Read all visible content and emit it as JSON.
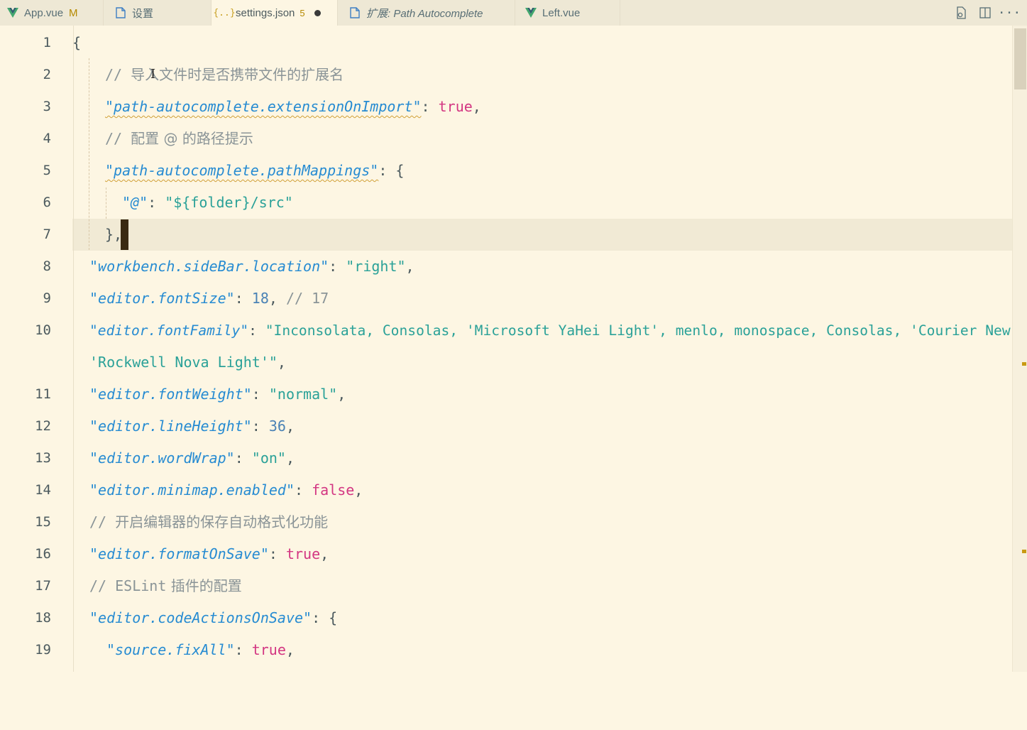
{
  "tabs": [
    {
      "label": "App.vue",
      "modified": "M",
      "icon": "vue-icon"
    },
    {
      "label": "设置",
      "icon": "settings-file-icon"
    },
    {
      "label": "settings.json",
      "count": "5",
      "icon": "json-icon",
      "active": true
    },
    {
      "label": "扩展: Path Autocomplete",
      "icon": "extension-file-icon"
    },
    {
      "label": "Left.vue",
      "icon": "vue-icon"
    }
  ],
  "toolbar": {
    "open_settings_icon": "open-settings-icon",
    "split_icon": "split-editor-icon",
    "more_icon": "more-actions-icon",
    "more_glyph": "···"
  },
  "editor": {
    "line_numbers": [
      "1",
      "2",
      "3",
      "4",
      "5",
      "6",
      "7",
      "8",
      "9",
      "10",
      "11",
      "12",
      "13",
      "14",
      "15",
      "16",
      "17",
      "18",
      "19"
    ],
    "l1": {
      "brace": "{"
    },
    "l2": {
      "slashes": "// ",
      "text": "导入文件时是否携带文件的扩展名"
    },
    "l3": {
      "key": "\"path-autocomplete.extensionOnImport\"",
      "colon": ": ",
      "value": "true",
      "tail": ","
    },
    "l4": {
      "slashes": "// ",
      "text": "配置 @ 的路径提示"
    },
    "l5": {
      "key": "\"path-autocomplete.pathMappings\"",
      "colon": ": ",
      "tail": "{"
    },
    "l6": {
      "key": "\"@\"",
      "colon": ": ",
      "value": "\"${folder}/src\""
    },
    "l7": {
      "text": "},"
    },
    "l8": {
      "key": "\"workbench.sideBar.location\"",
      "colon": ": ",
      "value": "\"right\"",
      "tail": ","
    },
    "l9": {
      "key": "\"editor.fontSize\"",
      "colon": ": ",
      "value": "18",
      "tail": ", ",
      "comment": "// 17"
    },
    "l10": {
      "key": "\"editor.fontFamily\"",
      "colon": ": ",
      "value": "\"Inconsolata, Consolas, 'Microsoft YaHei Light', menlo, monospace, Consolas, 'Courier New',",
      "wrap": "'Rockwell Nova Light'\"",
      "tail": ","
    },
    "l11": {
      "key": "\"editor.fontWeight\"",
      "colon": ": ",
      "value": "\"normal\"",
      "tail": ","
    },
    "l12": {
      "key": "\"editor.lineHeight\"",
      "colon": ": ",
      "value": "36",
      "tail": ","
    },
    "l13": {
      "key": "\"editor.wordWrap\"",
      "colon": ": ",
      "value": "\"on\"",
      "tail": ","
    },
    "l14": {
      "key": "\"editor.minimap.enabled\"",
      "colon": ": ",
      "value": "false",
      "tail": ","
    },
    "l15": {
      "slashes": "// ",
      "text": "开启编辑器的保存自动格式化功能"
    },
    "l16": {
      "key": "\"editor.formatOnSave\"",
      "colon": ": ",
      "value": "true",
      "tail": ","
    },
    "l17": {
      "slashes": "// ",
      "code": "ESLint",
      "text": " 插件的配置"
    },
    "l18": {
      "key": "\"editor.codeActionsOnSave\"",
      "colon": ": ",
      "tail": "{"
    },
    "l19": {
      "key": "\"source.fixAll\"",
      "colon": ": ",
      "value": "true",
      "tail": ","
    }
  },
  "colors": {
    "background": "#fdf6e3",
    "key": "#268bd2",
    "string": "#2aa198",
    "boolean": "#d33682",
    "number": "#4a82b5",
    "comment": "#8a9497",
    "warning": "#b58900"
  }
}
